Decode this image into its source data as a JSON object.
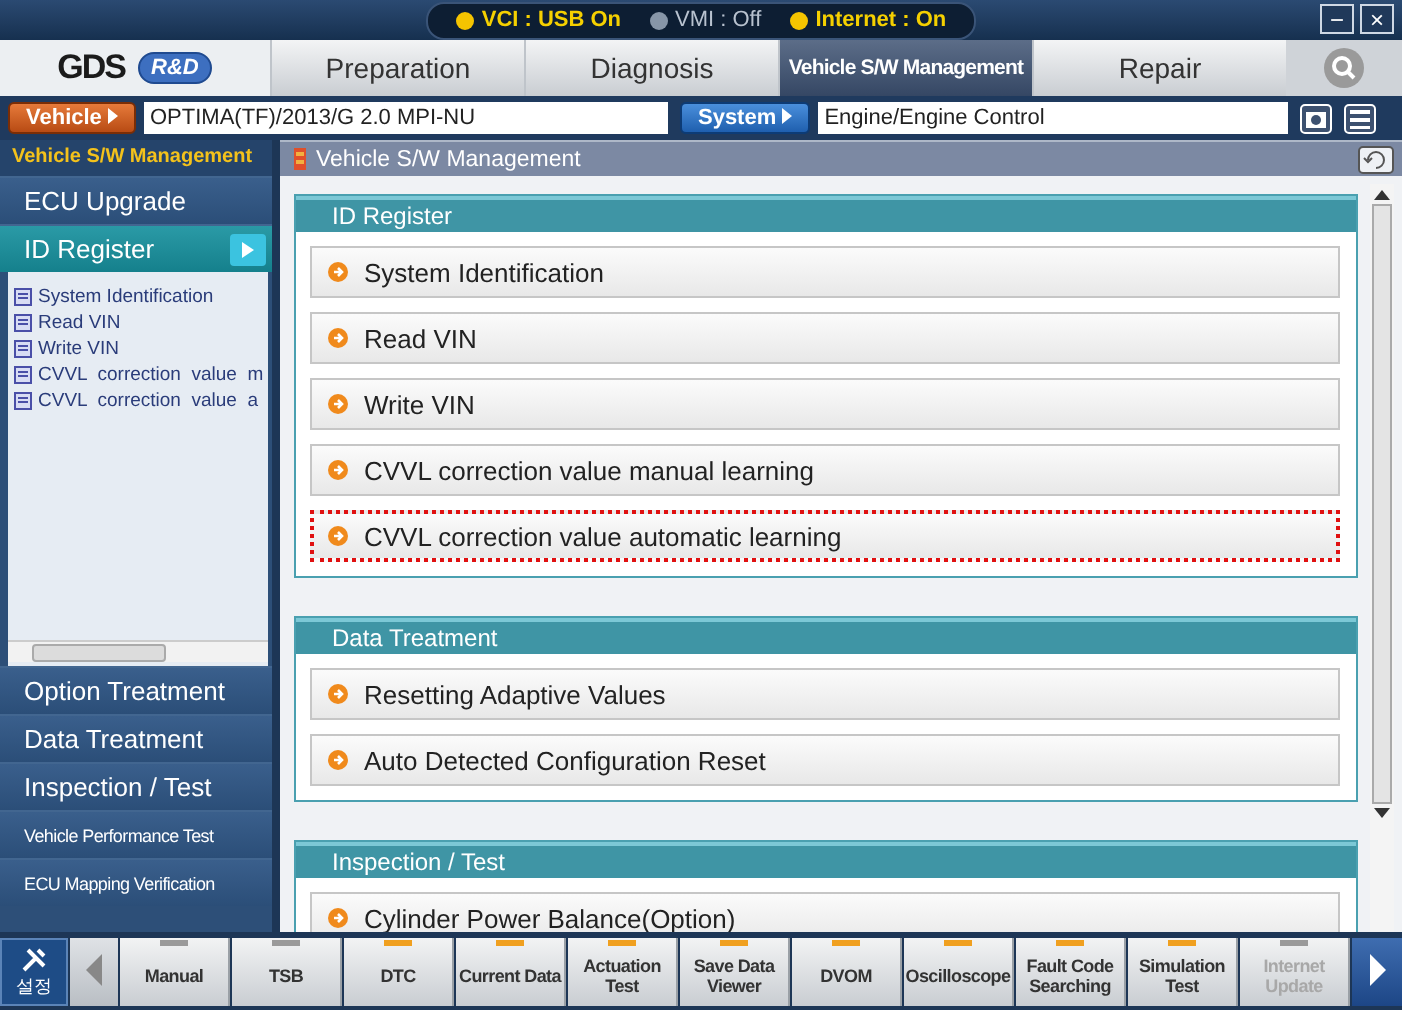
{
  "status": [
    {
      "label": "VCI : USB On",
      "on": true
    },
    {
      "label": "VMI : Off",
      "on": false
    },
    {
      "label": "Internet : On",
      "on": true
    }
  ],
  "window_controls": [
    "−",
    "×"
  ],
  "logo": {
    "text": "GDS",
    "badge": "R&D"
  },
  "tabs": [
    {
      "label": "Preparation",
      "selected": false
    },
    {
      "label": "Diagnosis",
      "selected": false
    },
    {
      "label": "Vehicle S/W Management",
      "selected": true
    },
    {
      "label": "Repair",
      "selected": false
    }
  ],
  "vehicle": {
    "label": "Vehicle",
    "value": "OPTIMA(TF)/2013/G 2.0 MPI-NU"
  },
  "system": {
    "label": "System",
    "value": "Engine/Engine Control"
  },
  "sidebar": {
    "title": "Vehicle S/W Management",
    "items": [
      {
        "label": "ECU Upgrade",
        "kind": "main",
        "selected": false
      },
      {
        "label": "ID Register",
        "kind": "main",
        "selected": true
      }
    ],
    "tree": [
      "System Identification",
      "Read VIN",
      "Write VIN",
      "CVVL  correction  value  m",
      "CVVL  correction  value  a"
    ],
    "more": [
      {
        "label": "Option Treatment",
        "kind": "main"
      },
      {
        "label": "Data Treatment",
        "kind": "main"
      },
      {
        "label": "Inspection / Test",
        "kind": "main"
      },
      {
        "label": "Vehicle Performance Test",
        "kind": "sub"
      },
      {
        "label": "ECU Mapping Verification",
        "kind": "sub"
      }
    ]
  },
  "content": {
    "title": "Vehicle S/W Management",
    "sections": [
      {
        "title": "ID Register",
        "items": [
          {
            "label": "System Identification",
            "selected": false
          },
          {
            "label": "Read VIN",
            "selected": false
          },
          {
            "label": "Write VIN",
            "selected": false
          },
          {
            "label": "CVVL correction value manual learning",
            "selected": false
          },
          {
            "label": "CVVL correction value automatic learning",
            "selected": true
          }
        ]
      },
      {
        "title": "Data Treatment",
        "items": [
          {
            "label": "Resetting Adaptive Values",
            "selected": false
          },
          {
            "label": "Auto Detected Configuration Reset",
            "selected": false
          }
        ]
      },
      {
        "title": "Inspection / Test",
        "items": [
          {
            "label": "Cylinder Power Balance(Option)",
            "selected": false
          }
        ]
      }
    ]
  },
  "toolbar": {
    "settings": "설정",
    "buttons": [
      {
        "label": "Manual",
        "active": false,
        "disabled": false
      },
      {
        "label": "TSB",
        "active": false,
        "disabled": false
      },
      {
        "label": "DTC",
        "active": true,
        "disabled": false
      },
      {
        "label": "Current Data",
        "active": true,
        "disabled": false
      },
      {
        "label": "Actuation Test",
        "active": true,
        "disabled": false
      },
      {
        "label": "Save Data Viewer",
        "active": true,
        "disabled": false
      },
      {
        "label": "DVOM",
        "active": true,
        "disabled": false
      },
      {
        "label": "Oscilloscope",
        "active": true,
        "disabled": false
      },
      {
        "label": "Fault Code Searching",
        "active": true,
        "disabled": false
      },
      {
        "label": "Simulation Test",
        "active": true,
        "disabled": false
      },
      {
        "label": "Internet Update",
        "active": false,
        "disabled": true
      }
    ]
  }
}
